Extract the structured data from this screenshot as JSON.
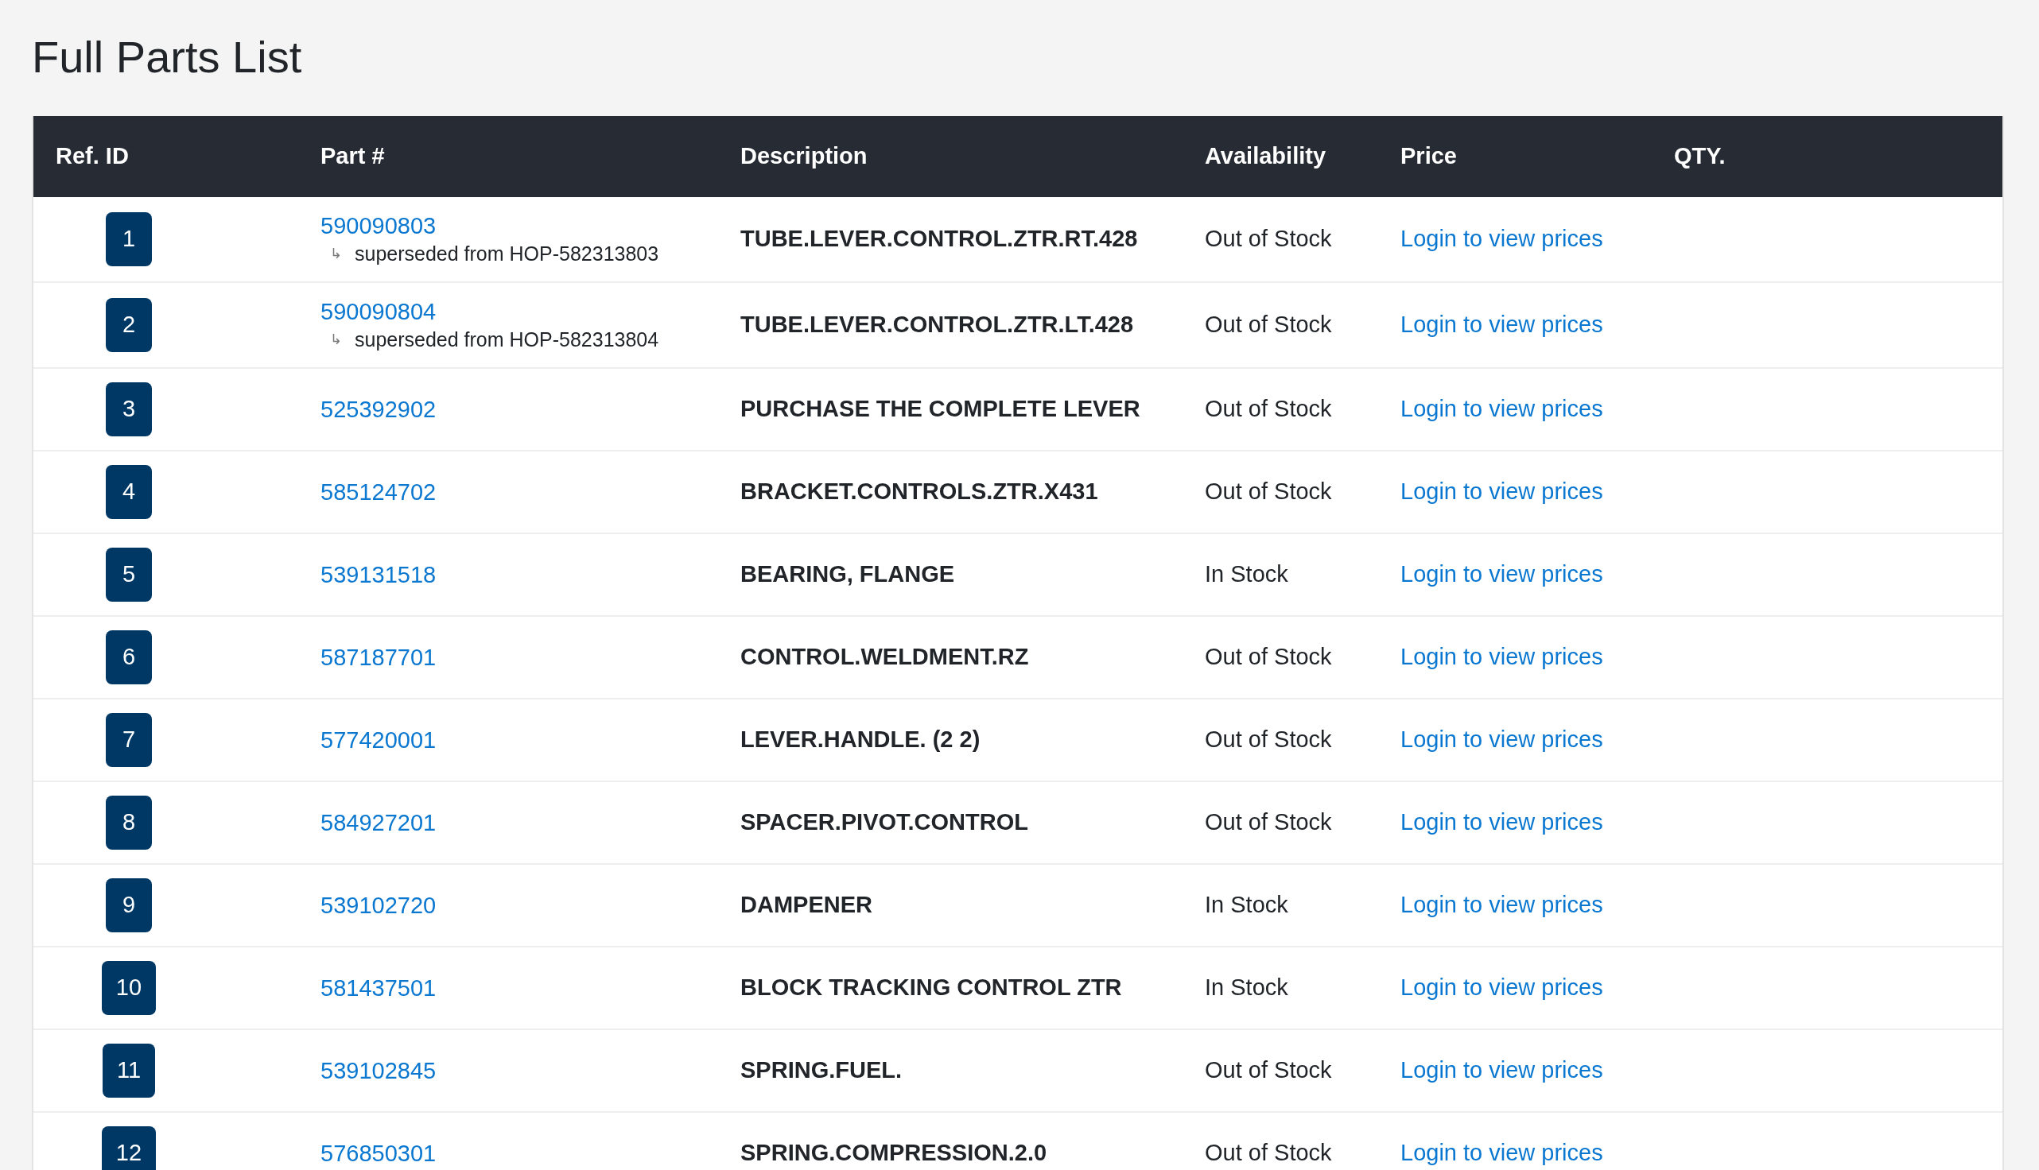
{
  "title": "Full Parts List",
  "table": {
    "columns": [
      "Ref. ID",
      "Part #",
      "Description",
      "Availability",
      "Price",
      "QTY."
    ],
    "rows": [
      {
        "ref": "1",
        "part": "590090803",
        "superseded": {
          "arrow": "↳",
          "text": "superseded from HOP-582313803"
        },
        "description": "TUBE.LEVER.CONTROL.ZTR.RT.428",
        "availability": "Out of Stock",
        "price": "Login to view prices"
      },
      {
        "ref": "2",
        "part": "590090804",
        "superseded": {
          "arrow": "↳",
          "text": "superseded from HOP-582313804"
        },
        "description": "TUBE.LEVER.CONTROL.ZTR.LT.428",
        "availability": "Out of Stock",
        "price": "Login to view prices"
      },
      {
        "ref": "3",
        "part": "525392902",
        "description": "PURCHASE THE COMPLETE LEVER",
        "availability": "Out of Stock",
        "price": "Login to view prices"
      },
      {
        "ref": "4",
        "part": "585124702",
        "description": "BRACKET.CONTROLS.ZTR.X431",
        "availability": "Out of Stock",
        "price": "Login to view prices"
      },
      {
        "ref": "5",
        "part": "539131518",
        "description": "BEARING, FLANGE",
        "availability": "In Stock",
        "price": "Login to view prices"
      },
      {
        "ref": "6",
        "part": "587187701",
        "description": "CONTROL.WELDMENT.RZ",
        "availability": "Out of Stock",
        "price": "Login to view prices"
      },
      {
        "ref": "7",
        "part": "577420001",
        "description": "LEVER.HANDLE. (2 2)",
        "availability": "Out of Stock",
        "price": "Login to view prices"
      },
      {
        "ref": "8",
        "part": "584927201",
        "description": "SPACER.PIVOT.CONTROL",
        "availability": "Out of Stock",
        "price": "Login to view prices"
      },
      {
        "ref": "9",
        "part": "539102720",
        "description": "DAMPENER",
        "availability": "In Stock",
        "price": "Login to view prices"
      },
      {
        "ref": "10",
        "part": "581437501",
        "description": "BLOCK TRACKING CONTROL ZTR",
        "availability": "In Stock",
        "price": "Login to view prices"
      },
      {
        "ref": "11",
        "part": "539102845",
        "description": "SPRING.FUEL.",
        "availability": "Out of Stock",
        "price": "Login to view prices"
      },
      {
        "ref": "12",
        "part": "576850301",
        "description": "SPRING.COMPRESSION.2.0",
        "availability": "Out of Stock",
        "price": "Login to view prices"
      }
    ]
  }
}
